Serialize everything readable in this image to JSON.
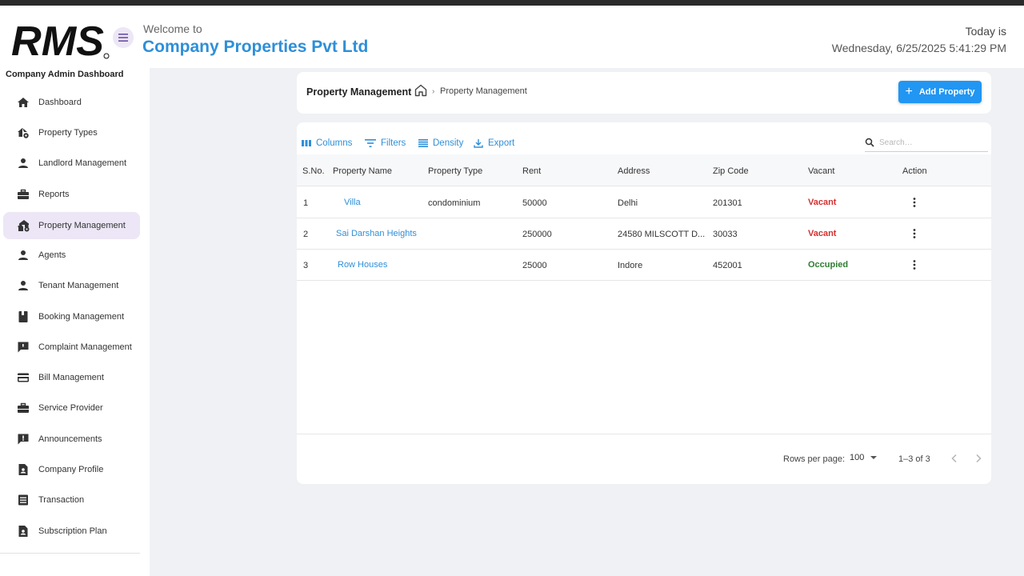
{
  "header": {
    "welcome_text": "Welcome to",
    "company_name": "Company Properties Pvt Ltd",
    "today_label": "Today is",
    "datetime": "Wednesday, 6/25/2025 5:41:29 PM"
  },
  "sidebar": {
    "title": "Company Admin Dashboard",
    "items": [
      {
        "label": "Dashboard",
        "icon": "home-icon"
      },
      {
        "label": "Property Types",
        "icon": "house-gear-icon"
      },
      {
        "label": "Landlord Management",
        "icon": "person-icon"
      },
      {
        "label": "Reports",
        "icon": "briefcase-icon"
      },
      {
        "label": "Property Management",
        "icon": "houses-gear-icon",
        "active": true
      },
      {
        "label": "Agents",
        "icon": "person-icon"
      },
      {
        "label": "Tenant Management",
        "icon": "person-icon"
      },
      {
        "label": "Booking Management",
        "icon": "book-icon"
      },
      {
        "label": "Complaint Management",
        "icon": "feedback-icon"
      },
      {
        "label": "Bill Management",
        "icon": "credit-card-icon"
      },
      {
        "label": "Service Provider",
        "icon": "toolbox-icon"
      },
      {
        "label": "Announcements",
        "icon": "announcement-icon"
      },
      {
        "label": "Company Profile",
        "icon": "profile-document-icon"
      },
      {
        "label": "Transaction",
        "icon": "list-document-icon"
      },
      {
        "label": "Subscription Plan",
        "icon": "subscription-icon"
      }
    ]
  },
  "page": {
    "title": "Property Management",
    "breadcrumb": "Property Management",
    "add_button": "Add Property"
  },
  "toolbar": {
    "columns": "Columns",
    "filters": "Filters",
    "density": "Density",
    "export": "Export",
    "search_placeholder": "Search…"
  },
  "table": {
    "headers": [
      "S.No.",
      "Property Name",
      "Property Type",
      "Rent",
      "Address",
      "Zip Code",
      "Vacant",
      "Action"
    ],
    "rows": [
      {
        "sno": "1",
        "name": "Villa",
        "type": "condominium",
        "rent": "50000",
        "address": "Delhi",
        "zip": "201301",
        "status": "Vacant",
        "status_kind": "vacant"
      },
      {
        "sno": "2",
        "name": "Sai Darshan Heights",
        "type": "",
        "rent": "250000",
        "address": "24580 MILSCOTT D...",
        "zip": "30033",
        "status": "Vacant",
        "status_kind": "vacant"
      },
      {
        "sno": "3",
        "name": "Row Houses",
        "type": "",
        "rent": "25000",
        "address": "Indore",
        "zip": "452001",
        "status": "Occupied",
        "status_kind": "occupied"
      }
    ]
  },
  "pagination": {
    "rows_per_page_label": "Rows per page:",
    "rows_per_page": "100",
    "range": "1–3 of 3"
  },
  "colors": {
    "accent": "#2e8fd8",
    "button": "#2196f3",
    "vacant": "#d32f2f",
    "occupied": "#2e7d32",
    "active_nav": "#ece6f6"
  }
}
